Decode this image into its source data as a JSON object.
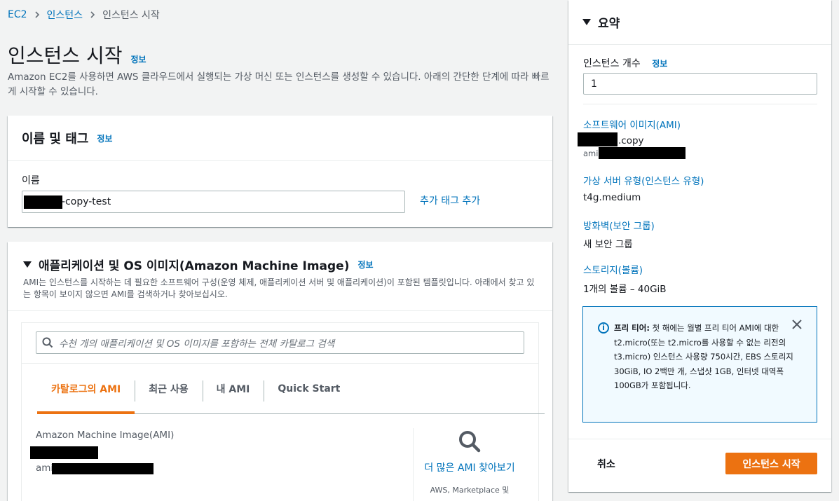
{
  "breadcrumb": {
    "items": [
      "EC2",
      "인스턴스",
      "인스턴스 시작"
    ]
  },
  "page": {
    "title": "인스턴스 시작",
    "info_link": "정보",
    "description": "Amazon EC2를 사용하면 AWS 클라우드에서 실행되는 가상 머신 또는 인스턴스를 생성할 수 있습니다. 아래의 간단한 단계에 따라 빠르게 시작할 수 있습니다."
  },
  "name_tags": {
    "title": "이름 및 태그",
    "info_link": "정보",
    "name_label": "이름",
    "name_value_suffix": "-copy-test",
    "add_tag_link": "추가 태그 추가"
  },
  "ami": {
    "title": "애플리케이션 및 OS 이미지(Amazon Machine Image)",
    "info_link": "정보",
    "description": "AMI는 인스턴스를 시작하는 데 필요한 소프트웨어 구성(운영 체제, 애플리케이션 서버 및 애플리케이션)이 포함된 템플릿입니다. 아래에서 찾고 있는 항목이 보이지 않으면 AMI를 검색하거나 찾아보십시오.",
    "search_placeholder": "수천 개의 애플리케이션 및 OS 이미지를 포함하는 전체 카탈로그 검색",
    "tabs": [
      "카탈로그의 AMI",
      "최근 사용",
      "내 AMI",
      "Quick Start"
    ],
    "active_tab": 0,
    "ami_label": "Amazon Machine Image(AMI)",
    "ami_id_prefix": "ami",
    "more_link": "더 많은 AMI 찾아보기",
    "more_sub": "AWS, Marketplace 및"
  },
  "summary": {
    "title": "요약",
    "instance_count_label": "인스턴스 개수",
    "info_link": "정보",
    "instance_count_value": "1",
    "software_image_label": "소프트웨어 이미지(AMI)",
    "software_image_suffix": ".copy",
    "software_image_id_prefix": "ami",
    "instance_type_label": "가상 서버 유형(인스턴스 유형)",
    "instance_type_value": "t4g.medium",
    "firewall_label": "방화벽(보안 그룹)",
    "firewall_value": "새 보안 그룹",
    "storage_label": "스토리지(볼륨)",
    "storage_value": "1개의 볼륨 – 40GiB",
    "free_tier_title": "프리 티어:",
    "free_tier_text": "첫 해에는 월별 프리 티어 AMI에 대한 t2.micro(또는 t2.micro를 사용할 수 없는 리전의 t3.micro) 인스턴스 사용량 750시간, EBS 스토리지 30GiB, IO 2백만 개, 스냅샷 1GB, 인터넷 대역폭 100GB가 포함됩니다.",
    "cancel_label": "취소",
    "launch_label": "인스턴스 시작"
  },
  "colors": {
    "accent": "#ec7211",
    "link": "#0073bb",
    "info_bg": "#f1faff"
  },
  "icons": [
    "chevron-right-icon",
    "caret-down-icon",
    "search-icon",
    "info-icon",
    "close-icon"
  ]
}
